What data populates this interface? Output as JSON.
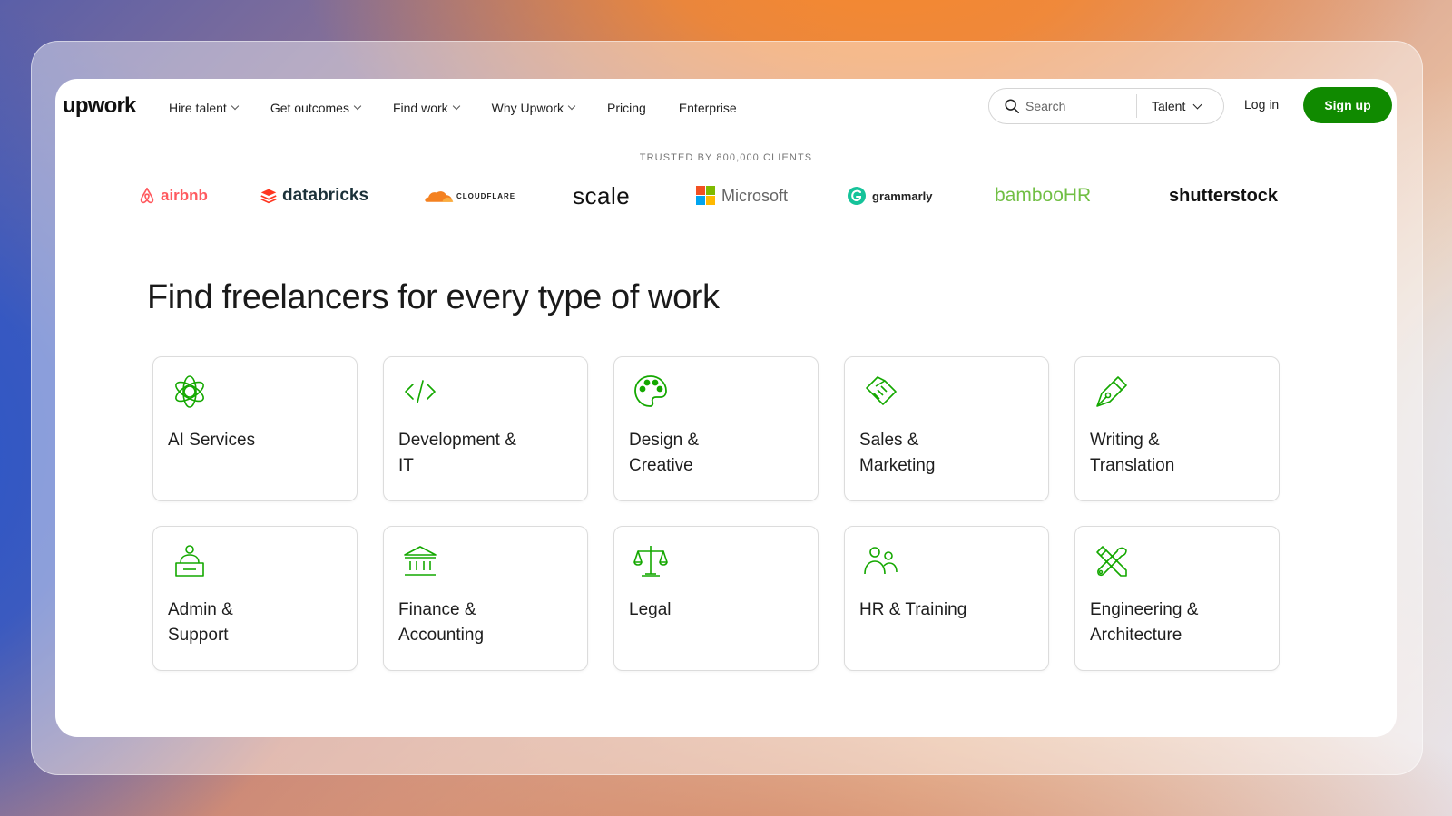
{
  "nav": {
    "logo": "upwork",
    "menu": [
      {
        "label": "Hire talent",
        "dropdown": true
      },
      {
        "label": "Get outcomes",
        "dropdown": true
      },
      {
        "label": "Find work",
        "dropdown": true
      },
      {
        "label": "Why Upwork",
        "dropdown": true
      },
      {
        "label": "Pricing",
        "dropdown": false
      },
      {
        "label": "Enterprise",
        "dropdown": false
      }
    ],
    "search_placeholder": "Search",
    "search_scope": "Talent",
    "login": "Log in",
    "signup": "Sign up"
  },
  "trusted": {
    "caption": "TRUSTED BY 800,000 CLIENTS",
    "brands": [
      "airbnb",
      "databricks",
      "CLOUDFLARE",
      "scale",
      "Microsoft",
      "grammarly",
      "bambooHR",
      "shutterstock"
    ]
  },
  "main": {
    "heading": "Find freelancers for every type of work",
    "categories": [
      {
        "line1": "AI Services",
        "line2": "",
        "icon": "ai-flower-icon"
      },
      {
        "line1": "Development &",
        "line2": "IT",
        "icon": "code-icon"
      },
      {
        "line1": "Design &",
        "line2": "Creative",
        "icon": "palette-icon"
      },
      {
        "line1": "Sales &",
        "line2": "Marketing",
        "icon": "handshake-icon"
      },
      {
        "line1": "Writing &",
        "line2": "Translation",
        "icon": "pen-nib-icon"
      },
      {
        "line1": "Admin &",
        "line2": "Support",
        "icon": "desk-person-icon"
      },
      {
        "line1": "Finance &",
        "line2": "Accounting",
        "icon": "bank-icon"
      },
      {
        "line1": "Legal",
        "line2": "",
        "icon": "scales-icon"
      },
      {
        "line1": "HR & Training",
        "line2": "",
        "icon": "people-icon"
      },
      {
        "line1": "Engineering &",
        "line2": "Architecture",
        "icon": "tools-icon"
      }
    ]
  },
  "colors": {
    "accent": "#108a00",
    "icon_green": "#14a800"
  }
}
